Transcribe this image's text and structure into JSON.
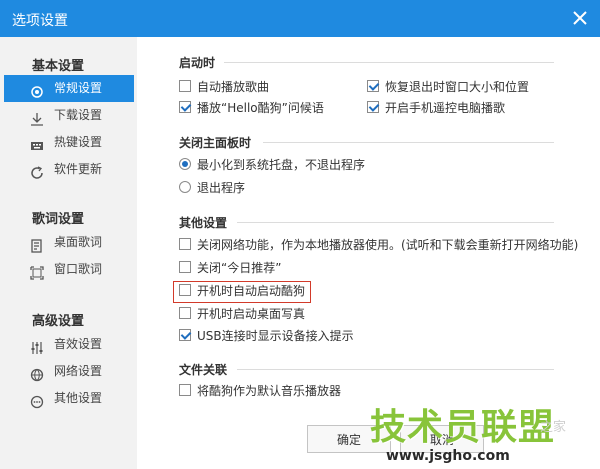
{
  "window": {
    "title": "选项设置"
  },
  "sidebar": {
    "sections": [
      {
        "title": "基本设置",
        "items": [
          {
            "label": "常规设置",
            "icon": "gear-icon",
            "active": true
          },
          {
            "label": "下载设置",
            "icon": "download-icon",
            "active": false
          },
          {
            "label": "热键设置",
            "icon": "keyboard-icon",
            "active": false
          },
          {
            "label": "软件更新",
            "icon": "refresh-icon",
            "active": false
          }
        ]
      },
      {
        "title": "歌词设置",
        "items": [
          {
            "label": "桌面歌词",
            "icon": "lyrics-icon",
            "active": false
          },
          {
            "label": "窗口歌词",
            "icon": "window-icon",
            "active": false
          }
        ]
      },
      {
        "title": "高级设置",
        "items": [
          {
            "label": "音效设置",
            "icon": "equalizer-icon",
            "active": false
          },
          {
            "label": "网络设置",
            "icon": "globe-icon",
            "active": false
          },
          {
            "label": "其他设置",
            "icon": "more-icon",
            "active": false
          }
        ]
      }
    ]
  },
  "groups": {
    "startup": {
      "title": "启动时",
      "options": [
        {
          "label": "自动播放歌曲",
          "checked": false
        },
        {
          "label": "恢复退出时窗口大小和位置",
          "checked": true
        },
        {
          "label": "播放“Hello酷狗”问候语",
          "checked": true
        },
        {
          "label": "开启手机遥控电脑播歌",
          "checked": true
        }
      ]
    },
    "close_panel": {
      "title": "关闭主面板时",
      "options": [
        {
          "label": "最小化到系统托盘，不退出程序",
          "selected": true
        },
        {
          "label": "退出程序",
          "selected": false
        }
      ]
    },
    "other": {
      "title": "其他设置",
      "options": [
        {
          "label": "关闭网络功能，作为本地播放器使用。(试听和下载会重新打开网络功能)",
          "checked": false
        },
        {
          "label": "关闭“今日推荐”",
          "checked": false
        },
        {
          "label": "开机时自动启动酷狗",
          "checked": false
        },
        {
          "label": "开机时启动桌面写真",
          "checked": false
        },
        {
          "label": "USB连接时显示设备接入提示",
          "checked": true
        }
      ]
    },
    "file_assoc": {
      "title": "文件关联",
      "options": [
        {
          "label": "将酷狗作为默认音乐播放器",
          "checked": false
        }
      ]
    }
  },
  "footer": {
    "ok_label": "确定",
    "cancel_label": "取消"
  },
  "watermark": {
    "main": "技术员联盟",
    "url": "www.jsgho.com",
    "sub": "之家"
  },
  "colors": {
    "accent": "#1f8ae0",
    "check": "#1f6ebf",
    "highlight_border": "#d23a2a",
    "watermark_green": "#88c43a"
  }
}
